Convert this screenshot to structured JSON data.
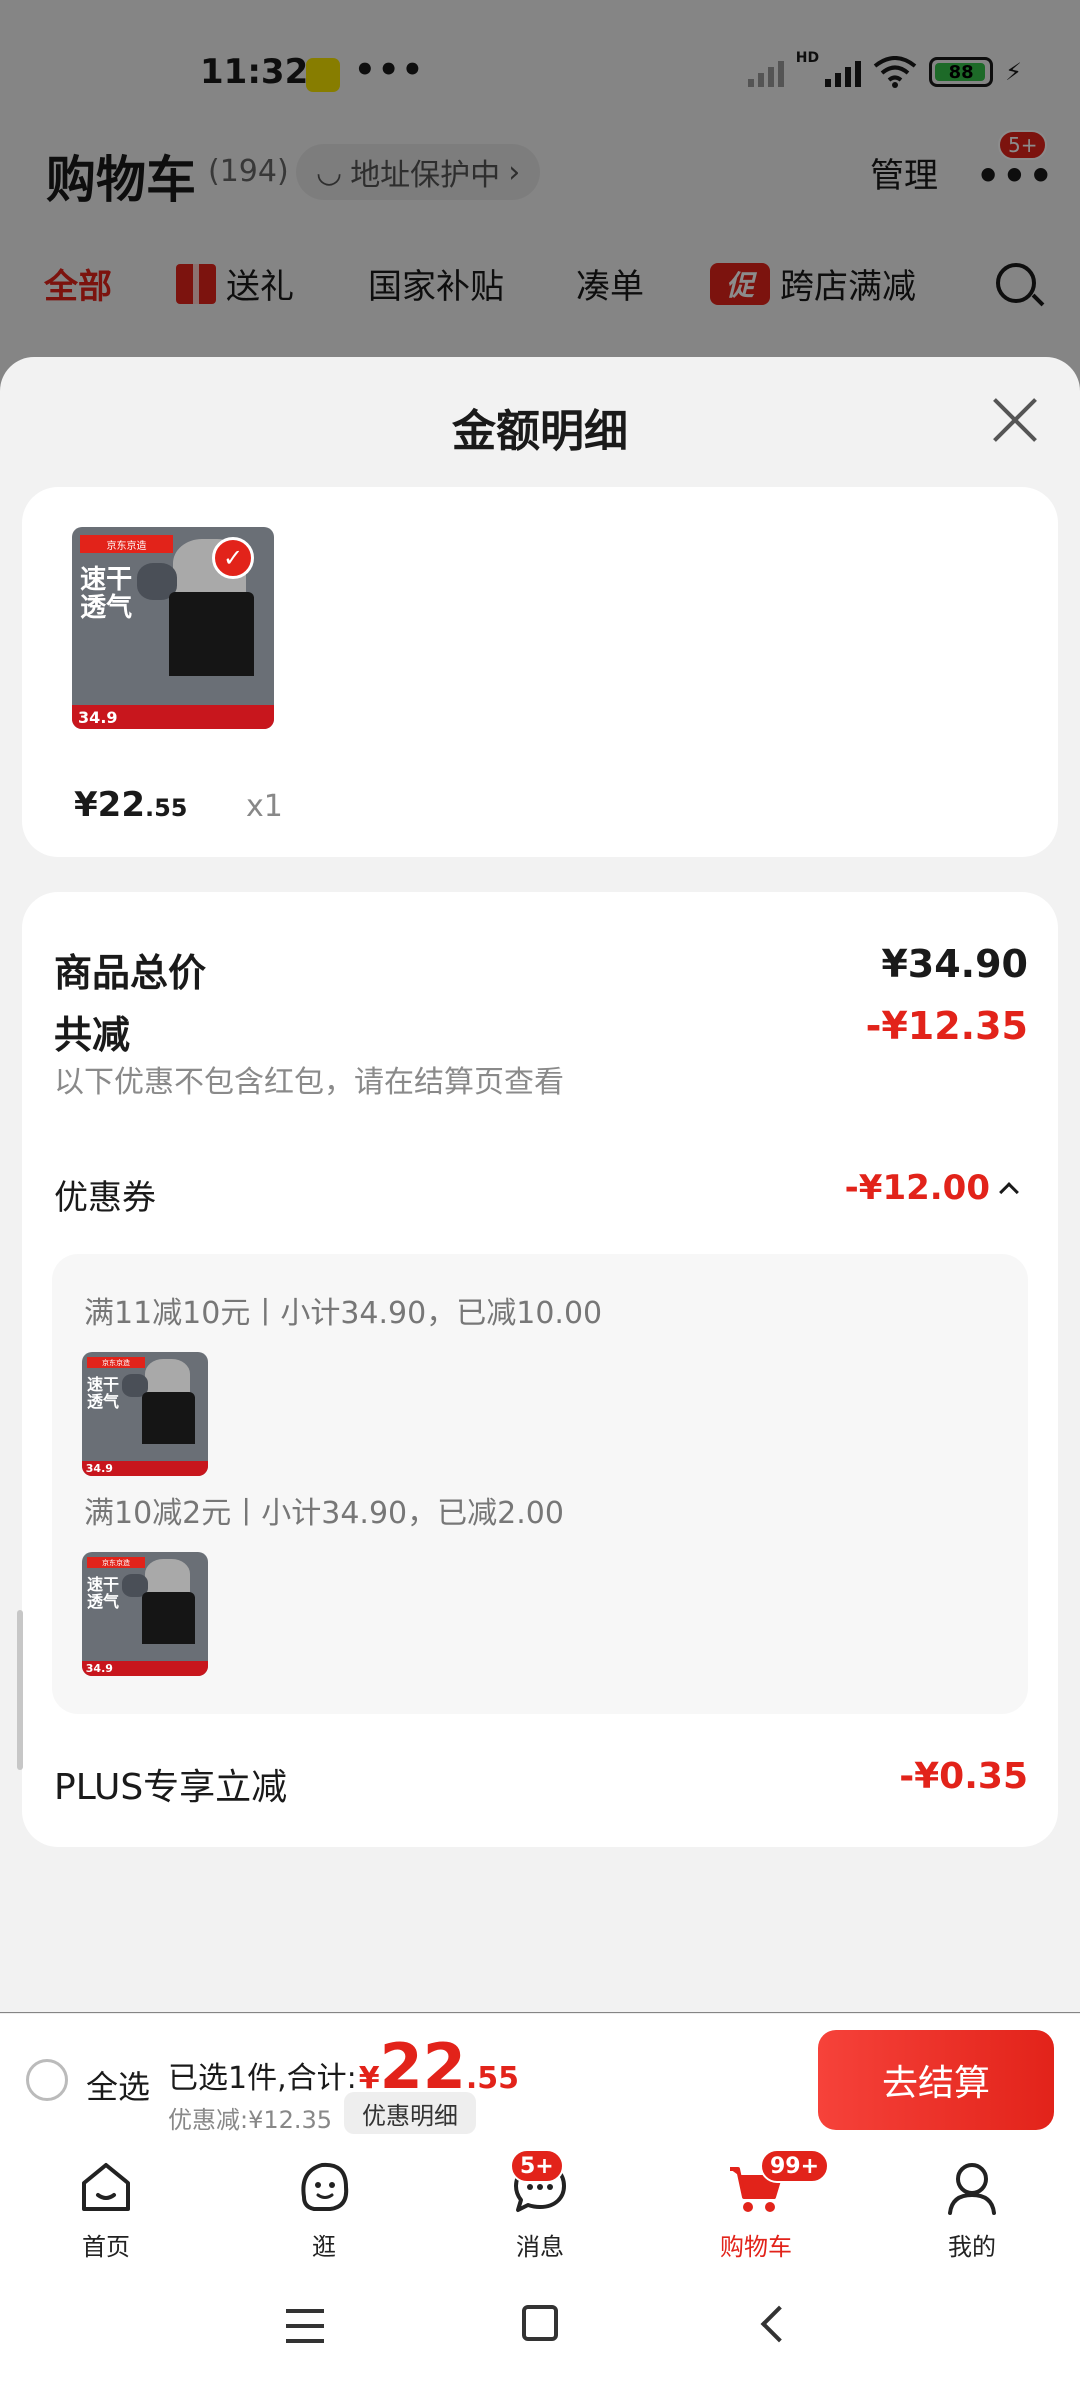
{
  "status_bar": {
    "time": "11:32",
    "dots": "•••",
    "hd": "HD",
    "battery": "88",
    "bolt": "⚡"
  },
  "cart_header": {
    "title": "购物车",
    "count": "(194)",
    "address": "地址保护中",
    "manage": "管理",
    "more": "•••",
    "badge": "5+"
  },
  "cart_tabs": [
    {
      "label": "全部"
    },
    {
      "label": "送礼"
    },
    {
      "label": "国家补贴"
    },
    {
      "label": "凑单"
    },
    {
      "label": "跨店满减",
      "icon_text": "促"
    }
  ],
  "sheet": {
    "title": "金额明细",
    "product": {
      "price_int": "¥22",
      "price_dec": ".55",
      "qty": "x1",
      "thumb_logo": "京东京造",
      "thumb_text": "速干\n透气",
      "thumb_price": "34.9"
    },
    "total_label": "商品总价",
    "total_value": "¥34.90",
    "reduce_label": "共减",
    "reduce_value": "-¥12.35",
    "note": "以下优惠不包含红包，请在结算页查看",
    "coupon_label": "优惠券",
    "coupon_value": "-¥12.00",
    "coupon_rules": [
      {
        "text": "满11减10元丨小计34.90，已减10.00"
      },
      {
        "text": "满10减2元丨小计34.90，已减2.00"
      }
    ],
    "plus_label": "PLUS专享立减",
    "plus_value": "-¥0.35"
  },
  "checkout": {
    "select_all": "全选",
    "selected_text": "已选1件,合计:",
    "currency": "¥",
    "total_int": "22",
    "total_dec": ".55",
    "discount_text": "优惠减:¥12.35",
    "detail_button": "优惠明细",
    "pay_button": "去结算"
  },
  "tabbar": [
    {
      "label": "首页"
    },
    {
      "label": "逛"
    },
    {
      "label": "消息",
      "badge": "5+"
    },
    {
      "label": "购物车",
      "badge": "99+"
    },
    {
      "label": "我的"
    }
  ],
  "colors": {
    "accent": "#e2231a",
    "sheet_bg": "#f2f2f2",
    "card_bg": "#ffffff"
  }
}
